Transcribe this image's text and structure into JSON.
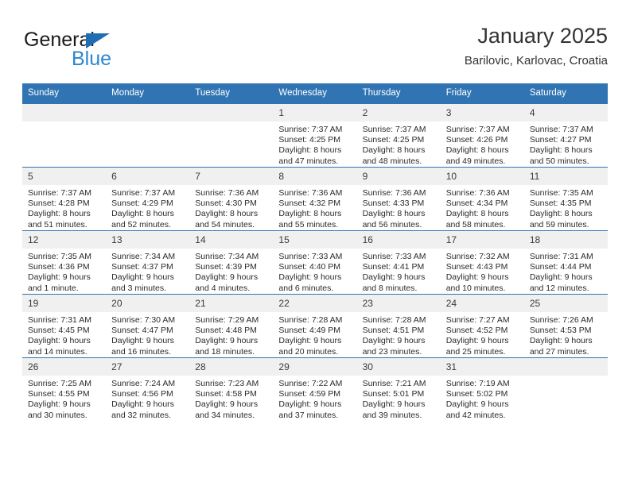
{
  "brand": {
    "word_one": "General",
    "word_two": "Blue",
    "triangle_icon": "triangle-icon"
  },
  "header": {
    "title": "January 2025",
    "subtitle": "Barilovic, Karlovac, Croatia"
  },
  "colors": {
    "header_blue": "#3174b3",
    "brand_blue": "#2a87d0",
    "daynum_bg": "#f0f0f0",
    "text": "#2b2b2b"
  },
  "weekdays": [
    "Sunday",
    "Monday",
    "Tuesday",
    "Wednesday",
    "Thursday",
    "Friday",
    "Saturday"
  ],
  "weeks": [
    [
      {
        "day": "",
        "empty": true
      },
      {
        "day": "",
        "empty": true
      },
      {
        "day": "",
        "empty": true
      },
      {
        "day": "1",
        "sunrise": "Sunrise: 7:37 AM",
        "sunset": "Sunset: 4:25 PM",
        "daylight1": "Daylight: 8 hours",
        "daylight2": "and 47 minutes."
      },
      {
        "day": "2",
        "sunrise": "Sunrise: 7:37 AM",
        "sunset": "Sunset: 4:25 PM",
        "daylight1": "Daylight: 8 hours",
        "daylight2": "and 48 minutes."
      },
      {
        "day": "3",
        "sunrise": "Sunrise: 7:37 AM",
        "sunset": "Sunset: 4:26 PM",
        "daylight1": "Daylight: 8 hours",
        "daylight2": "and 49 minutes."
      },
      {
        "day": "4",
        "sunrise": "Sunrise: 7:37 AM",
        "sunset": "Sunset: 4:27 PM",
        "daylight1": "Daylight: 8 hours",
        "daylight2": "and 50 minutes."
      }
    ],
    [
      {
        "day": "5",
        "sunrise": "Sunrise: 7:37 AM",
        "sunset": "Sunset: 4:28 PM",
        "daylight1": "Daylight: 8 hours",
        "daylight2": "and 51 minutes."
      },
      {
        "day": "6",
        "sunrise": "Sunrise: 7:37 AM",
        "sunset": "Sunset: 4:29 PM",
        "daylight1": "Daylight: 8 hours",
        "daylight2": "and 52 minutes."
      },
      {
        "day": "7",
        "sunrise": "Sunrise: 7:36 AM",
        "sunset": "Sunset: 4:30 PM",
        "daylight1": "Daylight: 8 hours",
        "daylight2": "and 54 minutes."
      },
      {
        "day": "8",
        "sunrise": "Sunrise: 7:36 AM",
        "sunset": "Sunset: 4:32 PM",
        "daylight1": "Daylight: 8 hours",
        "daylight2": "and 55 minutes."
      },
      {
        "day": "9",
        "sunrise": "Sunrise: 7:36 AM",
        "sunset": "Sunset: 4:33 PM",
        "daylight1": "Daylight: 8 hours",
        "daylight2": "and 56 minutes."
      },
      {
        "day": "10",
        "sunrise": "Sunrise: 7:36 AM",
        "sunset": "Sunset: 4:34 PM",
        "daylight1": "Daylight: 8 hours",
        "daylight2": "and 58 minutes."
      },
      {
        "day": "11",
        "sunrise": "Sunrise: 7:35 AM",
        "sunset": "Sunset: 4:35 PM",
        "daylight1": "Daylight: 8 hours",
        "daylight2": "and 59 minutes."
      }
    ],
    [
      {
        "day": "12",
        "sunrise": "Sunrise: 7:35 AM",
        "sunset": "Sunset: 4:36 PM",
        "daylight1": "Daylight: 9 hours",
        "daylight2": "and 1 minute."
      },
      {
        "day": "13",
        "sunrise": "Sunrise: 7:34 AM",
        "sunset": "Sunset: 4:37 PM",
        "daylight1": "Daylight: 9 hours",
        "daylight2": "and 3 minutes."
      },
      {
        "day": "14",
        "sunrise": "Sunrise: 7:34 AM",
        "sunset": "Sunset: 4:39 PM",
        "daylight1": "Daylight: 9 hours",
        "daylight2": "and 4 minutes."
      },
      {
        "day": "15",
        "sunrise": "Sunrise: 7:33 AM",
        "sunset": "Sunset: 4:40 PM",
        "daylight1": "Daylight: 9 hours",
        "daylight2": "and 6 minutes."
      },
      {
        "day": "16",
        "sunrise": "Sunrise: 7:33 AM",
        "sunset": "Sunset: 4:41 PM",
        "daylight1": "Daylight: 9 hours",
        "daylight2": "and 8 minutes."
      },
      {
        "day": "17",
        "sunrise": "Sunrise: 7:32 AM",
        "sunset": "Sunset: 4:43 PM",
        "daylight1": "Daylight: 9 hours",
        "daylight2": "and 10 minutes."
      },
      {
        "day": "18",
        "sunrise": "Sunrise: 7:31 AM",
        "sunset": "Sunset: 4:44 PM",
        "daylight1": "Daylight: 9 hours",
        "daylight2": "and 12 minutes."
      }
    ],
    [
      {
        "day": "19",
        "sunrise": "Sunrise: 7:31 AM",
        "sunset": "Sunset: 4:45 PM",
        "daylight1": "Daylight: 9 hours",
        "daylight2": "and 14 minutes."
      },
      {
        "day": "20",
        "sunrise": "Sunrise: 7:30 AM",
        "sunset": "Sunset: 4:47 PM",
        "daylight1": "Daylight: 9 hours",
        "daylight2": "and 16 minutes."
      },
      {
        "day": "21",
        "sunrise": "Sunrise: 7:29 AM",
        "sunset": "Sunset: 4:48 PM",
        "daylight1": "Daylight: 9 hours",
        "daylight2": "and 18 minutes."
      },
      {
        "day": "22",
        "sunrise": "Sunrise: 7:28 AM",
        "sunset": "Sunset: 4:49 PM",
        "daylight1": "Daylight: 9 hours",
        "daylight2": "and 20 minutes."
      },
      {
        "day": "23",
        "sunrise": "Sunrise: 7:28 AM",
        "sunset": "Sunset: 4:51 PM",
        "daylight1": "Daylight: 9 hours",
        "daylight2": "and 23 minutes."
      },
      {
        "day": "24",
        "sunrise": "Sunrise: 7:27 AM",
        "sunset": "Sunset: 4:52 PM",
        "daylight1": "Daylight: 9 hours",
        "daylight2": "and 25 minutes."
      },
      {
        "day": "25",
        "sunrise": "Sunrise: 7:26 AM",
        "sunset": "Sunset: 4:53 PM",
        "daylight1": "Daylight: 9 hours",
        "daylight2": "and 27 minutes."
      }
    ],
    [
      {
        "day": "26",
        "sunrise": "Sunrise: 7:25 AM",
        "sunset": "Sunset: 4:55 PM",
        "daylight1": "Daylight: 9 hours",
        "daylight2": "and 30 minutes."
      },
      {
        "day": "27",
        "sunrise": "Sunrise: 7:24 AM",
        "sunset": "Sunset: 4:56 PM",
        "daylight1": "Daylight: 9 hours",
        "daylight2": "and 32 minutes."
      },
      {
        "day": "28",
        "sunrise": "Sunrise: 7:23 AM",
        "sunset": "Sunset: 4:58 PM",
        "daylight1": "Daylight: 9 hours",
        "daylight2": "and 34 minutes."
      },
      {
        "day": "29",
        "sunrise": "Sunrise: 7:22 AM",
        "sunset": "Sunset: 4:59 PM",
        "daylight1": "Daylight: 9 hours",
        "daylight2": "and 37 minutes."
      },
      {
        "day": "30",
        "sunrise": "Sunrise: 7:21 AM",
        "sunset": "Sunset: 5:01 PM",
        "daylight1": "Daylight: 9 hours",
        "daylight2": "and 39 minutes."
      },
      {
        "day": "31",
        "sunrise": "Sunrise: 7:19 AM",
        "sunset": "Sunset: 5:02 PM",
        "daylight1": "Daylight: 9 hours",
        "daylight2": "and 42 minutes."
      },
      {
        "day": "",
        "empty": true
      }
    ]
  ]
}
